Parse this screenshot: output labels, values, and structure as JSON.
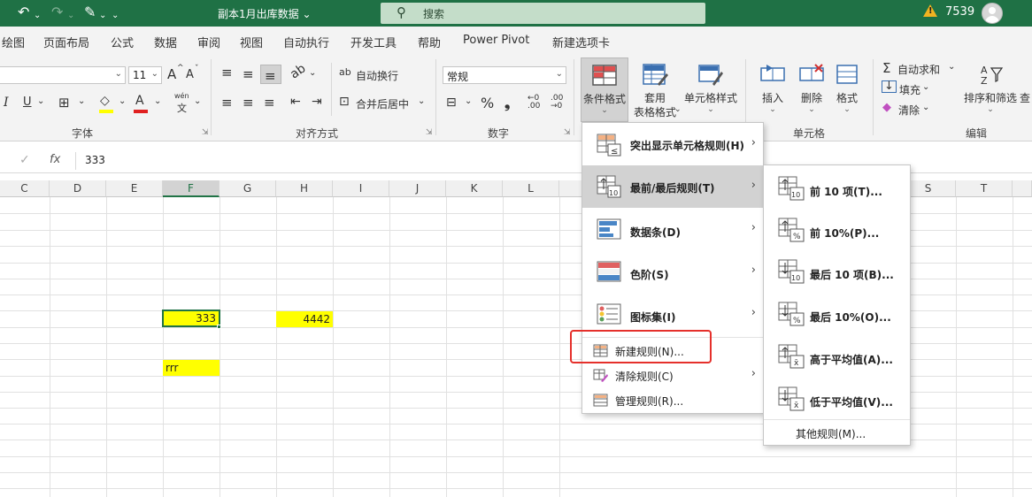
{
  "title_bar": {
    "doc_title": "副本1月出库数据",
    "doc_title_chevron": "⌄",
    "search_placeholder": "搜索",
    "user_number": "7539",
    "qat_undo_glyph": "↶",
    "qat_redo_glyph": "↷",
    "qat_brush_glyph": "✎",
    "qat_more_glyph": "⌄",
    "search_glyph": "⚲"
  },
  "tabs": [
    "绘图",
    "页面布局",
    "公式",
    "数据",
    "审阅",
    "视图",
    "自动执行",
    "开发工具",
    "帮助",
    "Power Pivot",
    "新建选项卡"
  ],
  "ribbon": {
    "font": {
      "size_value": "11",
      "grow_label": "A",
      "shrink_label": "A",
      "italic": "I",
      "underline": "U",
      "phonetic_top": "wén",
      "phonetic_bottom": "文",
      "group_label": "字体"
    },
    "alignment": {
      "wrap_text": "自动换行",
      "merge_center": "合并后居中",
      "group_label": "对齐方式"
    },
    "number": {
      "format_value": "常规",
      "percent": "%",
      "comma": "❟",
      "group_label": "数字"
    },
    "styles": {
      "conditional_format": "条件格式",
      "format_as_table_1": "套用",
      "format_as_table_2": "表格格式",
      "cell_styles": "单元格样式"
    },
    "cells": {
      "insert": "插入",
      "delete": "删除",
      "format": "格式",
      "group_label": "单元格"
    },
    "editing": {
      "autosum": "自动求和",
      "fill": "填充",
      "clear": "清除",
      "sort_filter": "排序和筛选",
      "find_cut": "查",
      "group_label": "编辑"
    }
  },
  "formula_bar": {
    "cancel_glyph": "✓",
    "fx": "fx",
    "value": "333"
  },
  "grid": {
    "columns": [
      "C",
      "D",
      "E",
      "F",
      "G",
      "H",
      "I",
      "J",
      "K",
      "L",
      "S",
      "T"
    ],
    "cells": {
      "F_value": "333",
      "H_value": "4442",
      "F_text": "rrr"
    }
  },
  "cf_menu": {
    "items": [
      {
        "label": "突出显示单元格规则(H)"
      },
      {
        "label": "最前/最后规则(T)"
      },
      {
        "label": "数据条(D)"
      },
      {
        "label": "色阶(S)"
      },
      {
        "label": "图标集(I)"
      }
    ],
    "small_items": [
      {
        "label": "新建规则(N)..."
      },
      {
        "label": "清除规则(C)"
      },
      {
        "label": "管理规则(R)..."
      }
    ]
  },
  "submenu": {
    "items": [
      {
        "label": "前 10 项(T)...",
        "badge": "10"
      },
      {
        "label": "前 10%(P)...",
        "badge": "%"
      },
      {
        "label": "最后 10 项(B)...",
        "badge": "10"
      },
      {
        "label": "最后 10%(O)...",
        "badge": "%"
      },
      {
        "label": "高于平均值(A)...",
        "badge": "x̄"
      },
      {
        "label": "低于平均值(V)...",
        "badge": "x̄"
      }
    ],
    "other_rules": "其他规则(M)..."
  },
  "colors": {
    "title_green": "#1f7145",
    "excel_green": "#217346",
    "cell_yellow": "#ffff00",
    "highlight_red": "#e5302b"
  }
}
